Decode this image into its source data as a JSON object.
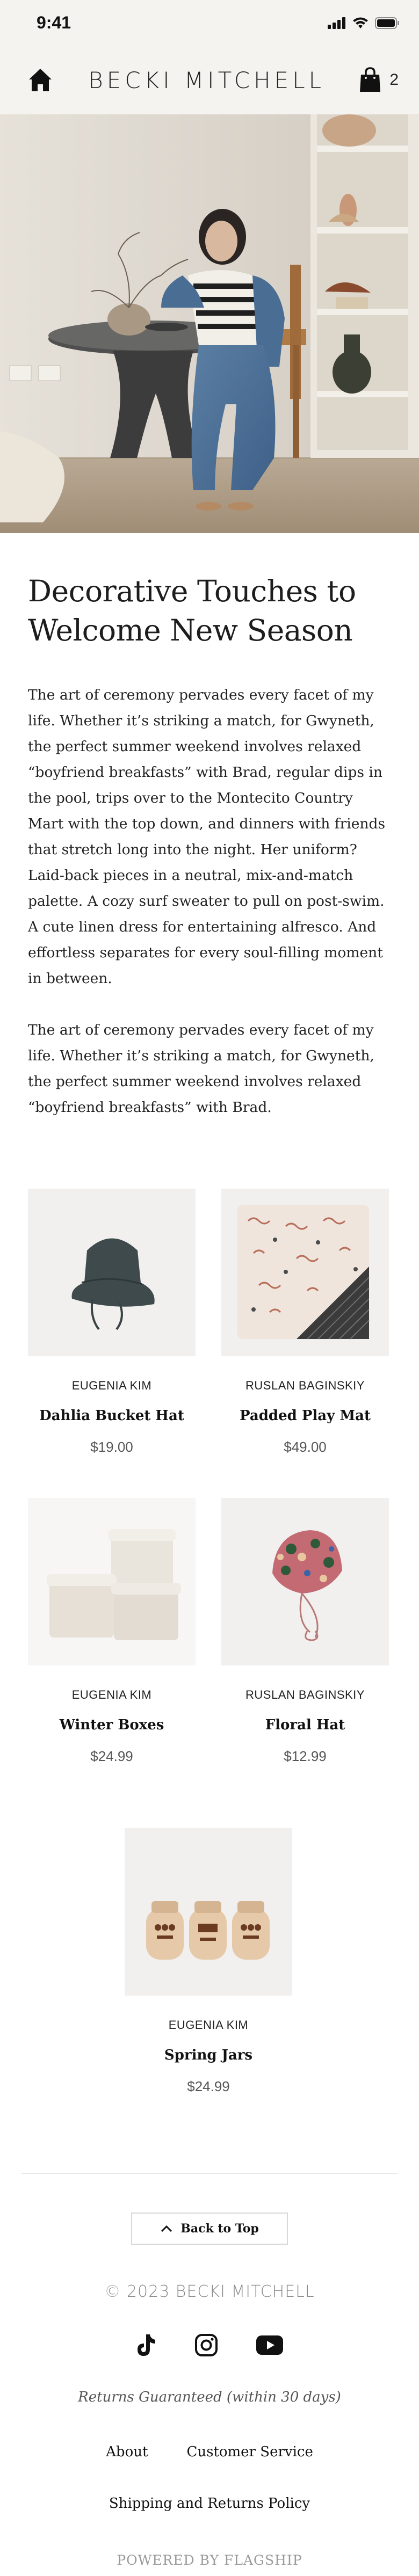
{
  "status_bar": {
    "time": "9:41",
    "icons": [
      "signal-icon",
      "wifi-icon",
      "battery-icon"
    ]
  },
  "header": {
    "brand": "BECKI MITCHELL",
    "cart_count": "2",
    "icons": [
      "home-icon",
      "shopping-bag-icon"
    ]
  },
  "article": {
    "title_line1": "Decorative Touches to",
    "title_line2": "Welcome New Season",
    "paragraph1": "The art of ceremony pervades every facet of my life. Whether it’s striking a match, for Gwyneth, the perfect summer weekend involves relaxed “boyfriend breakfasts” with Brad, regular dips in the pool, trips over to the Montecito Country Mart with the top down, and dinners with friends that stretch long into the night. Her uniform? Laid-back pieces in a neutral, mix-and-match palette. A cozy surf sweater to pull on post-swim. A cute linen dress for entertaining alfresco. And effortless separates for every soul-filling moment in between.",
    "paragraph2": "The art of ceremony pervades every facet of my life. Whether it’s striking a match, for Gwyneth, the perfect summer weekend involves relaxed “boyfriend breakfasts” with Brad."
  },
  "products": [
    {
      "brand": "EUGENIA KIM",
      "name": "Dahlia Bucket Hat",
      "price": "$19.00"
    },
    {
      "brand": "RUSLAN BAGINSKIY",
      "name": "Padded Play Mat",
      "price": "$49.00"
    },
    {
      "brand": "EUGENIA KIM",
      "name": "Winter Boxes",
      "price": "$24.99"
    },
    {
      "brand": "RUSLAN BAGINSKIY",
      "name": "Floral Hat",
      "price": "$12.99"
    },
    {
      "brand": "EUGENIA KIM",
      "name": "Spring Jars",
      "price": "$24.99"
    }
  ],
  "footer": {
    "back_to_top": "Back to Top",
    "copyright": "© 2023 BECKI MITCHELL",
    "social_icons": [
      "tiktok-icon",
      "instagram-icon",
      "youtube-icon"
    ],
    "guarantee": "Returns Guaranteed (within 30 days)",
    "link_about": "About",
    "link_customer_service": "Customer Service",
    "link_shipping": "Shipping and Returns Policy",
    "powered_by": "POWERED BY FLAGSHIP"
  },
  "colors": {
    "header_bg": "#f5f3ef",
    "product_bg": "#f1f0ee",
    "accent_text": "#111111"
  }
}
